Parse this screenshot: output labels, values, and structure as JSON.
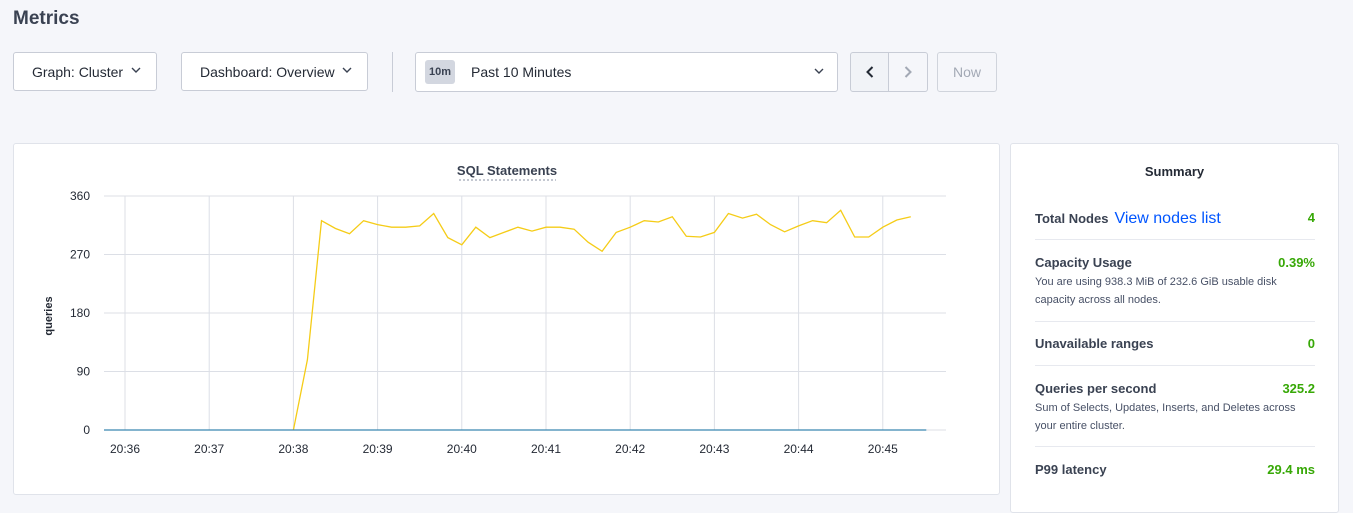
{
  "page": {
    "title": "Metrics"
  },
  "toolbar": {
    "graph_label": "Graph: Cluster",
    "dashboard_label": "Dashboard: Overview",
    "time_badge": "10m",
    "time_label": "Past 10 Minutes",
    "now_label": "Now"
  },
  "colors": {
    "accent_link": "#0055ff",
    "good": "#37a806",
    "series_queries": "#f5cc17",
    "series_baseline": "#3a88b0"
  },
  "chart_data": {
    "type": "line",
    "title": "SQL Statements",
    "ylabel": "queries",
    "xlabel": "",
    "ylim": [
      0,
      360
    ],
    "yticks": [
      "360",
      "270",
      "180",
      "90",
      "0"
    ],
    "xlim": [
      0,
      571
    ],
    "xtick_values": [
      0,
      60,
      120,
      180,
      240,
      300,
      360,
      420,
      480,
      540
    ],
    "xticks": [
      "20:36",
      "20:37",
      "20:38",
      "20:39",
      "20:40",
      "20:41",
      "20:42",
      "20:43",
      "20:44",
      "20:45"
    ],
    "grid": true,
    "series": [
      {
        "color": "#f5cc17",
        "points": [
          [
            120,
            0
          ],
          [
            130,
            108
          ],
          [
            140,
            322
          ],
          [
            150,
            310
          ],
          [
            160,
            302
          ],
          [
            170,
            322
          ],
          [
            180,
            316
          ],
          [
            190,
            312
          ],
          [
            200,
            312
          ],
          [
            210,
            314
          ],
          [
            220,
            333
          ],
          [
            230,
            296
          ],
          [
            240,
            285
          ],
          [
            250,
            312
          ],
          [
            260,
            296
          ],
          [
            270,
            304
          ],
          [
            280,
            312
          ],
          [
            290,
            306
          ],
          [
            300,
            312
          ],
          [
            310,
            312
          ],
          [
            320,
            309
          ],
          [
            330,
            289
          ],
          [
            340,
            275
          ],
          [
            350,
            304
          ],
          [
            360,
            312
          ],
          [
            370,
            322
          ],
          [
            380,
            320
          ],
          [
            390,
            328
          ],
          [
            400,
            298
          ],
          [
            410,
            297
          ],
          [
            420,
            304
          ],
          [
            430,
            333
          ],
          [
            440,
            326
          ],
          [
            450,
            332
          ],
          [
            460,
            316
          ],
          [
            470,
            305
          ],
          [
            480,
            314
          ],
          [
            490,
            322
          ],
          [
            500,
            319
          ],
          [
            510,
            338
          ],
          [
            520,
            297
          ],
          [
            530,
            297
          ],
          [
            540,
            312
          ],
          [
            550,
            323
          ],
          [
            560,
            328
          ]
        ]
      },
      {
        "color": "#3a88b0",
        "points": [
          [
            -15,
            0
          ],
          [
            571,
            0
          ]
        ]
      }
    ]
  },
  "summary": {
    "title": "Summary",
    "total_nodes": {
      "label": "Total Nodes",
      "link": "View nodes list",
      "value": "4"
    },
    "capacity": {
      "label": "Capacity Usage",
      "value": "0.39%",
      "desc": "You are using 938.3 MiB of 232.6 GiB usable disk capacity across all nodes."
    },
    "unavailable": {
      "label": "Unavailable ranges",
      "value": "0"
    },
    "qps": {
      "label": "Queries per second",
      "value": "325.2",
      "desc": "Sum of Selects, Updates, Inserts, and Deletes across your entire cluster."
    },
    "p99": {
      "label": "P99 latency",
      "value": "29.4 ms"
    }
  }
}
